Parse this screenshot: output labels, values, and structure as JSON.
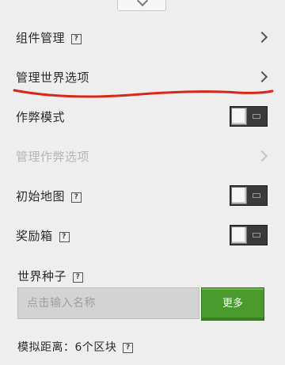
{
  "rows": {
    "components": {
      "label": "组件管理"
    },
    "world_options": {
      "label": "管理世界选项"
    },
    "cheats": {
      "label": "作弊模式",
      "enabled": false
    },
    "cheat_options": {
      "label": "管理作弊选项"
    },
    "starting_map": {
      "label": "初始地图",
      "enabled": false
    },
    "bonus_chest": {
      "label": "奖励箱",
      "enabled": false
    }
  },
  "seed": {
    "title": "世界种子",
    "placeholder": "点击输入名称",
    "button_label": "更多"
  },
  "distance": {
    "label": "模拟距离：6个区块"
  },
  "icons": {
    "help": "help-icon",
    "chevron": "chevron-right-icon"
  },
  "help_glyph": "?",
  "annotation_color": "#d8281a",
  "accent_green": "#4a9a2e"
}
